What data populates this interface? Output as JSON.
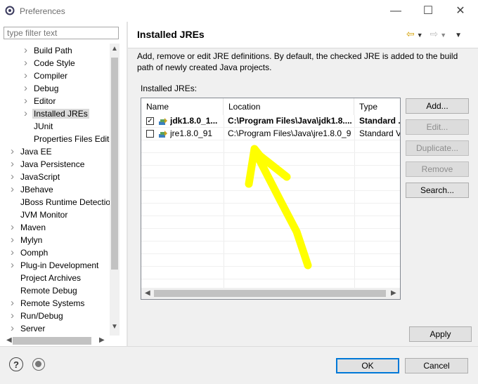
{
  "window": {
    "title": "Preferences"
  },
  "filter": {
    "placeholder": "type filter text"
  },
  "tree": {
    "items": [
      {
        "label": "Build Path",
        "level": 2,
        "expandable": true
      },
      {
        "label": "Code Style",
        "level": 2,
        "expandable": true
      },
      {
        "label": "Compiler",
        "level": 2,
        "expandable": true
      },
      {
        "label": "Debug",
        "level": 2,
        "expandable": true
      },
      {
        "label": "Editor",
        "level": 2,
        "expandable": true
      },
      {
        "label": "Installed JREs",
        "level": 2,
        "expandable": true,
        "selected": true
      },
      {
        "label": "JUnit",
        "level": 2,
        "expandable": false
      },
      {
        "label": "Properties Files Edito",
        "level": 2,
        "expandable": false
      },
      {
        "label": "Java EE",
        "level": 1,
        "expandable": true
      },
      {
        "label": "Java Persistence",
        "level": 1,
        "expandable": true
      },
      {
        "label": "JavaScript",
        "level": 1,
        "expandable": true
      },
      {
        "label": "JBehave",
        "level": 1,
        "expandable": true
      },
      {
        "label": "JBoss Runtime Detection",
        "level": 1,
        "expandable": false
      },
      {
        "label": "JVM Monitor",
        "level": 1,
        "expandable": false
      },
      {
        "label": "Maven",
        "level": 1,
        "expandable": true
      },
      {
        "label": "Mylyn",
        "level": 1,
        "expandable": true
      },
      {
        "label": "Oomph",
        "level": 1,
        "expandable": true
      },
      {
        "label": "Plug-in Development",
        "level": 1,
        "expandable": true
      },
      {
        "label": "Project Archives",
        "level": 1,
        "expandable": false
      },
      {
        "label": "Remote Debug",
        "level": 1,
        "expandable": false
      },
      {
        "label": "Remote Systems",
        "level": 1,
        "expandable": true
      },
      {
        "label": "Run/Debug",
        "level": 1,
        "expandable": true
      },
      {
        "label": "Server",
        "level": 1,
        "expandable": true
      }
    ]
  },
  "page": {
    "title": "Installed JREs",
    "description": "Add, remove or edit JRE definitions. By default, the checked JRE is added to the build path of newly created Java projects.",
    "table_label": "Installed JREs:",
    "columns": [
      "Name",
      "Location",
      "Type"
    ],
    "rows": [
      {
        "checked": true,
        "name": "jdk1.8.0_1...",
        "location": "C:\\Program Files\\Java\\jdk1.8....",
        "type": "Standard ...",
        "bold": true
      },
      {
        "checked": false,
        "name": "jre1.8.0_91",
        "location": "C:\\Program Files\\Java\\jre1.8.0_91",
        "type": "Standard V",
        "bold": false
      }
    ],
    "buttons": {
      "add": "Add...",
      "edit": "Edit...",
      "duplicate": "Duplicate...",
      "remove": "Remove",
      "search": "Search..."
    },
    "apply": "Apply"
  },
  "footer": {
    "ok": "OK",
    "cancel": "Cancel"
  },
  "colors": {
    "accent": "#0078d7",
    "annotation": "#ffff00",
    "selection": "#d9d9d9"
  },
  "icons": [
    "preferences-icon",
    "minimize-icon",
    "maximize-icon",
    "close-icon",
    "back-icon",
    "forward-icon",
    "menu-icon",
    "help-icon",
    "record-icon",
    "jre-icon"
  ]
}
